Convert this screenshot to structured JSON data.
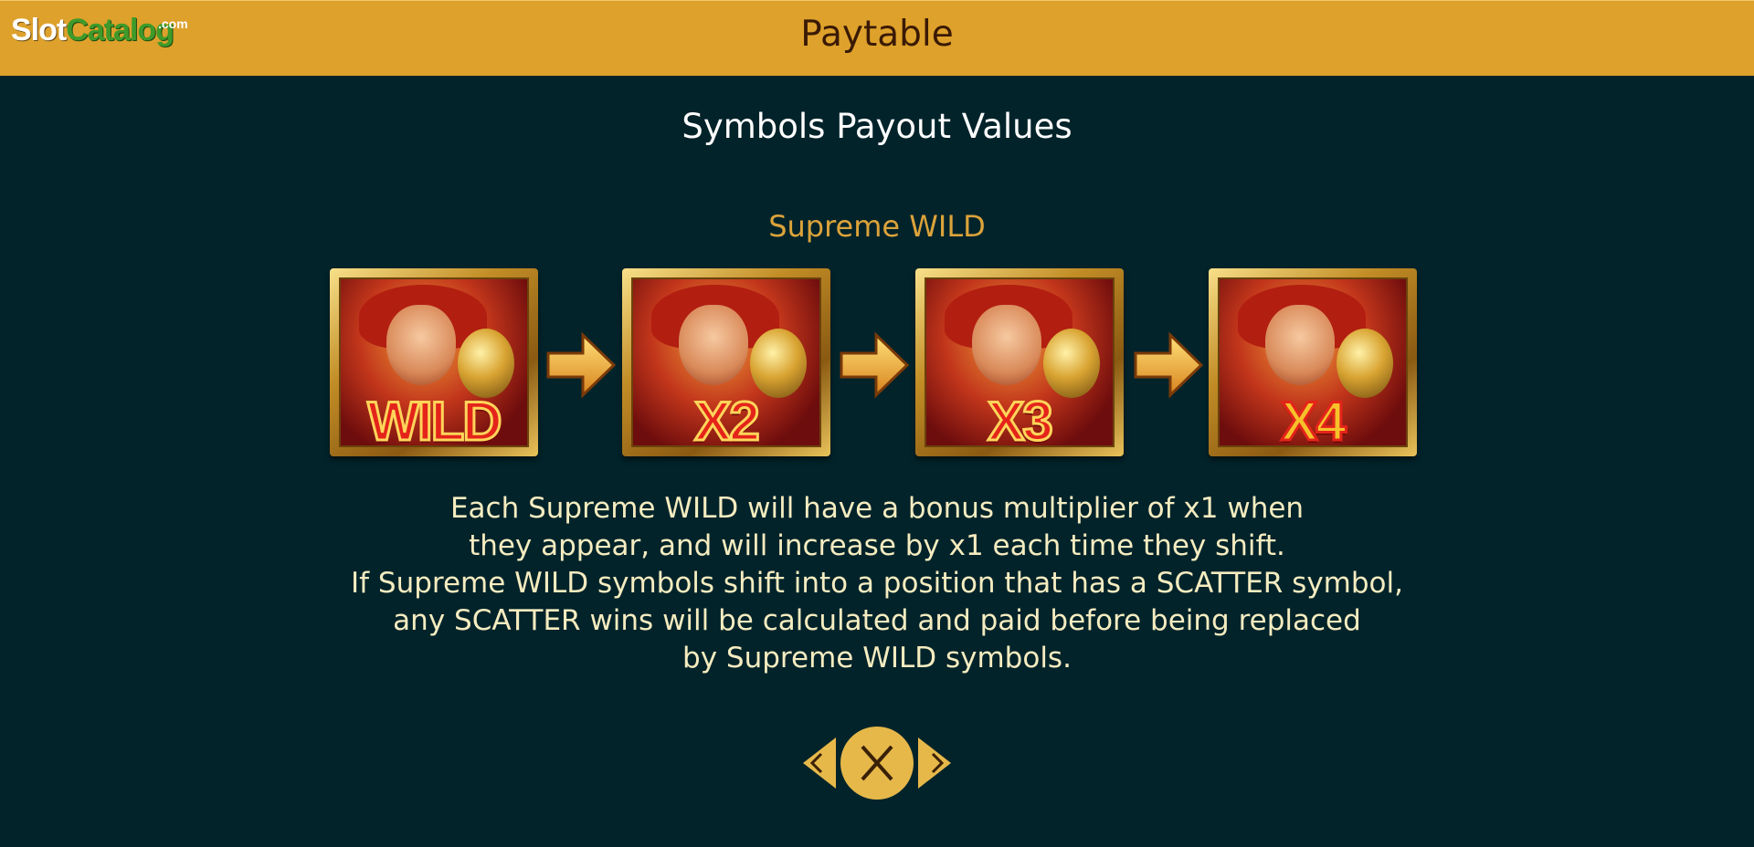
{
  "header": {
    "logo_slot": "Slot",
    "logo_catalog": "Catalog",
    "logo_com": ".com",
    "title": "Paytable"
  },
  "section": {
    "title": "Symbols Payout Values",
    "symbol_name": "Supreme WILD"
  },
  "symbols": [
    {
      "label": "WILD",
      "icon": "monkey-king-wild-icon"
    },
    {
      "label": "X2",
      "icon": "monkey-king-x2-icon"
    },
    {
      "label": "X3",
      "icon": "monkey-king-x3-icon"
    },
    {
      "label": "X4",
      "icon": "monkey-king-x4-icon"
    }
  ],
  "description": {
    "lines": [
      "Each Supreme WILD will have a bonus multiplier of x1 when",
      "they appear, and will increase by x1 each time they shift.",
      "If Supreme WILD symbols shift into a position that has a SCATTER symbol,",
      "any SCATTER wins will be calculated and paid before being replaced",
      "by Supreme WILD symbols."
    ]
  },
  "nav": {
    "prev_icon": "chevron-left-icon",
    "close_icon": "close-icon",
    "next_icon": "chevron-right-icon"
  },
  "colors": {
    "header_bg": "#dea12b",
    "page_bg": "#02232a",
    "accent_gold": "#dca33a",
    "text_cream": "#f5ecc0"
  }
}
